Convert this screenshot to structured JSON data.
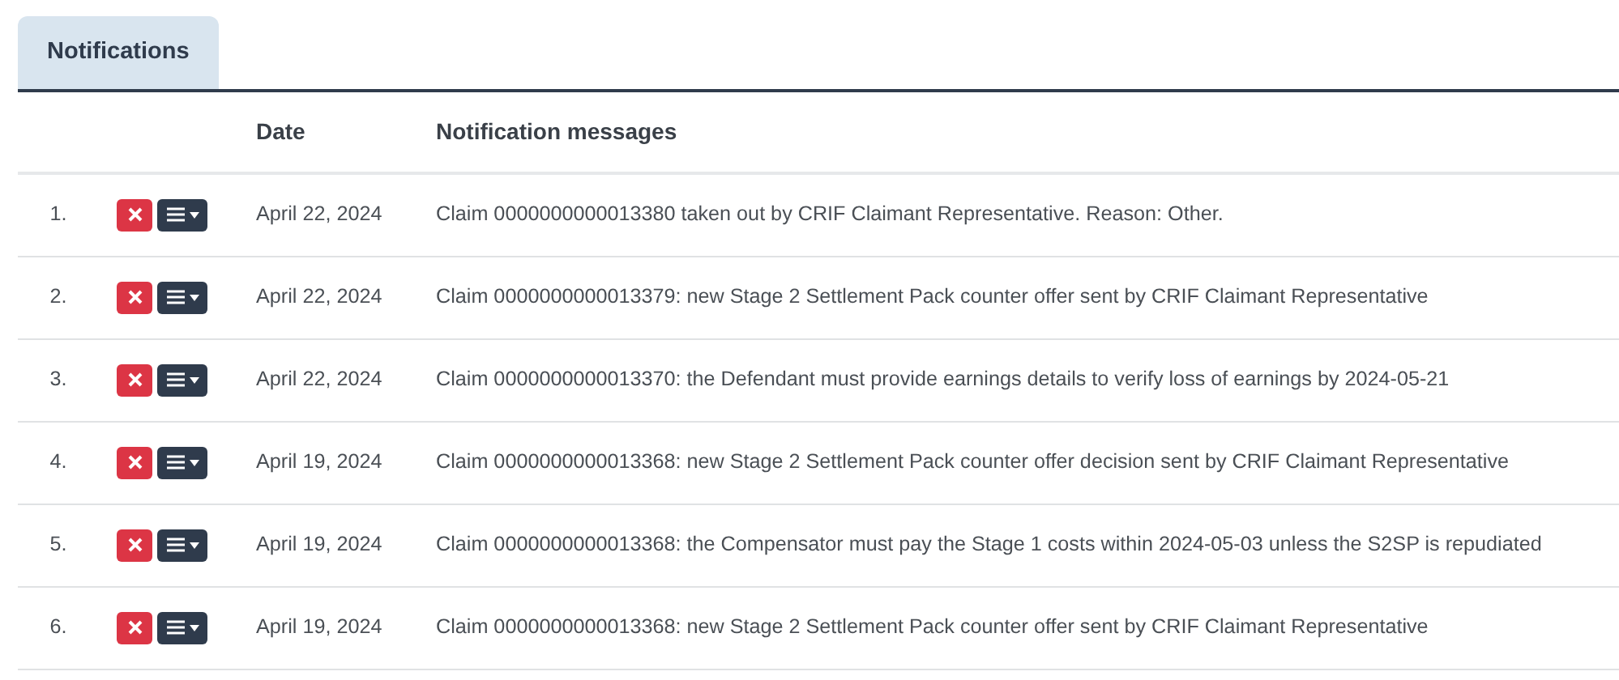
{
  "tabs": [
    {
      "label": "Notifications",
      "selected": true
    }
  ],
  "table": {
    "columns": [
      "Date",
      "Notification messages"
    ],
    "rows": [
      {
        "number": "1.",
        "date": "April 22, 2024",
        "message": "Claim 0000000000013380 taken out by CRIF Claimant Representative. Reason: Other."
      },
      {
        "number": "2.",
        "date": "April 22, 2024",
        "message": "Claim 0000000000013379: new Stage 2 Settlement Pack counter offer sent by CRIF Claimant Representative"
      },
      {
        "number": "3.",
        "date": "April 22, 2024",
        "message": "Claim 0000000000013370: the Defendant must provide earnings details to verify loss of earnings by 2024-05-21"
      },
      {
        "number": "4.",
        "date": "April 19, 2024",
        "message": "Claim 0000000000013368: new Stage 2 Settlement Pack counter offer decision sent by CRIF Claimant Representative"
      },
      {
        "number": "5.",
        "date": "April 19, 2024",
        "message": "Claim 0000000000013368: the Compensator must pay the Stage 1 costs within 2024-05-03 unless the S2SP is repudiated"
      },
      {
        "number": "6.",
        "date": "April 19, 2024",
        "message": "Claim 0000000000013368: new Stage 2 Settlement Pack counter offer sent by CRIF Claimant Representative"
      }
    ]
  }
}
